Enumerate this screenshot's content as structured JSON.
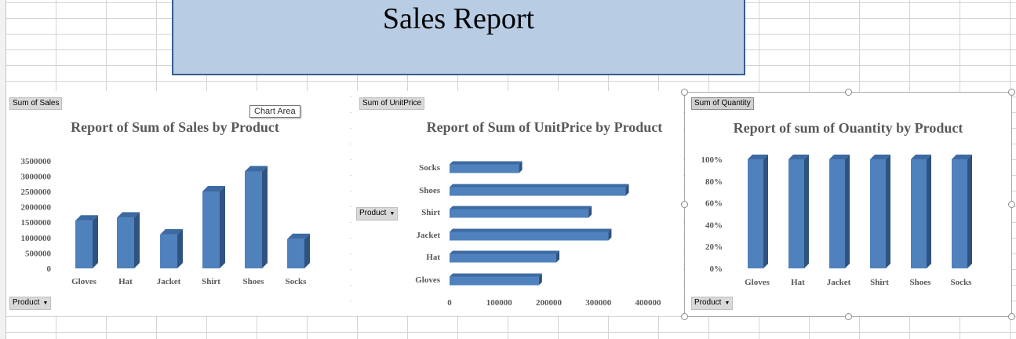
{
  "report_title": "Sales Report",
  "colors": {
    "bar_front": "#4f81bd",
    "bar_side": "#2f5380",
    "bar_top": "#3d6aa3",
    "title_fill": "#b8cce4",
    "title_border": "#385d8a"
  },
  "tooltip": "Chart Area",
  "charts": [
    {
      "field_button": "Sum of Sales",
      "axis_button": "Product",
      "title": "Report of Sum of Sales by Product"
    },
    {
      "field_button": "Sum of UnitPrice",
      "axis_button": "Product",
      "title": "Report of Sum of UnitPrice by Product"
    },
    {
      "field_button": "Sum of Quantity",
      "axis_button": "Product",
      "title": "Report of sum of Ouantity by Product"
    }
  ],
  "chart_data": [
    {
      "type": "bar",
      "orientation": "vertical",
      "title": "Report of Sum of Sales by Product",
      "categories": [
        "Gloves",
        "Hat",
        "Jacket",
        "Shirt",
        "Shoes",
        "Socks"
      ],
      "values": [
        1550000,
        1650000,
        1100000,
        2500000,
        3150000,
        950000
      ],
      "ylim": [
        0,
        3500000
      ],
      "yticks": [
        "0",
        "500000",
        "1000000",
        "1500000",
        "2000000",
        "2500000",
        "3000000",
        "3500000"
      ],
      "legend": false,
      "grid": false
    },
    {
      "type": "bar",
      "orientation": "horizontal",
      "title": "Report of Sum of UnitPrice by Product",
      "categories": [
        "Gloves",
        "Hat",
        "Jacket",
        "Shirt",
        "Shoes",
        "Socks"
      ],
      "values": [
        180000,
        215000,
        320000,
        280000,
        355000,
        140000
      ],
      "xlim": [
        0,
        400000
      ],
      "xticks": [
        "0",
        "100000",
        "200000",
        "300000",
        "400000"
      ],
      "legend": false,
      "grid": false
    },
    {
      "type": "bar",
      "orientation": "vertical",
      "title": "Report of sum of Ouantity by Product",
      "categories": [
        "Gloves",
        "Hat",
        "Jacket",
        "Shirt",
        "Shoes",
        "Socks"
      ],
      "values": [
        1.0,
        1.0,
        1.0,
        1.0,
        1.0,
        1.0
      ],
      "ylim": [
        0,
        1
      ],
      "yticks": [
        "0%",
        "20%",
        "40%",
        "60%",
        "80%",
        "100%"
      ],
      "legend": false,
      "grid": false
    }
  ]
}
